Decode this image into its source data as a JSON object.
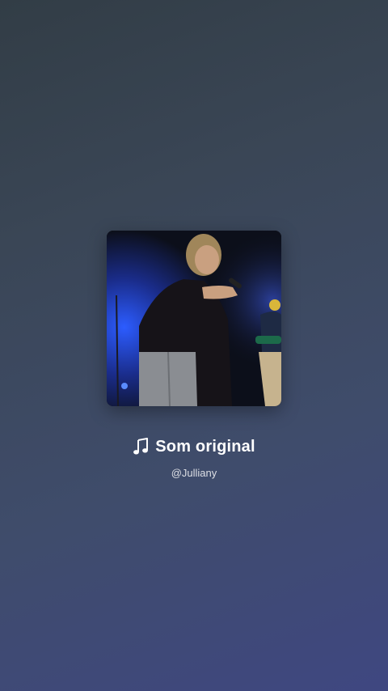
{
  "sound": {
    "title": "Som original",
    "author": "@Julliany",
    "icon": "music-note-icon"
  },
  "colors": {
    "background_top": "#323d46",
    "background_bottom": "#3f4781",
    "text_primary": "#ffffff",
    "stage_light": "#1e4bd6"
  }
}
